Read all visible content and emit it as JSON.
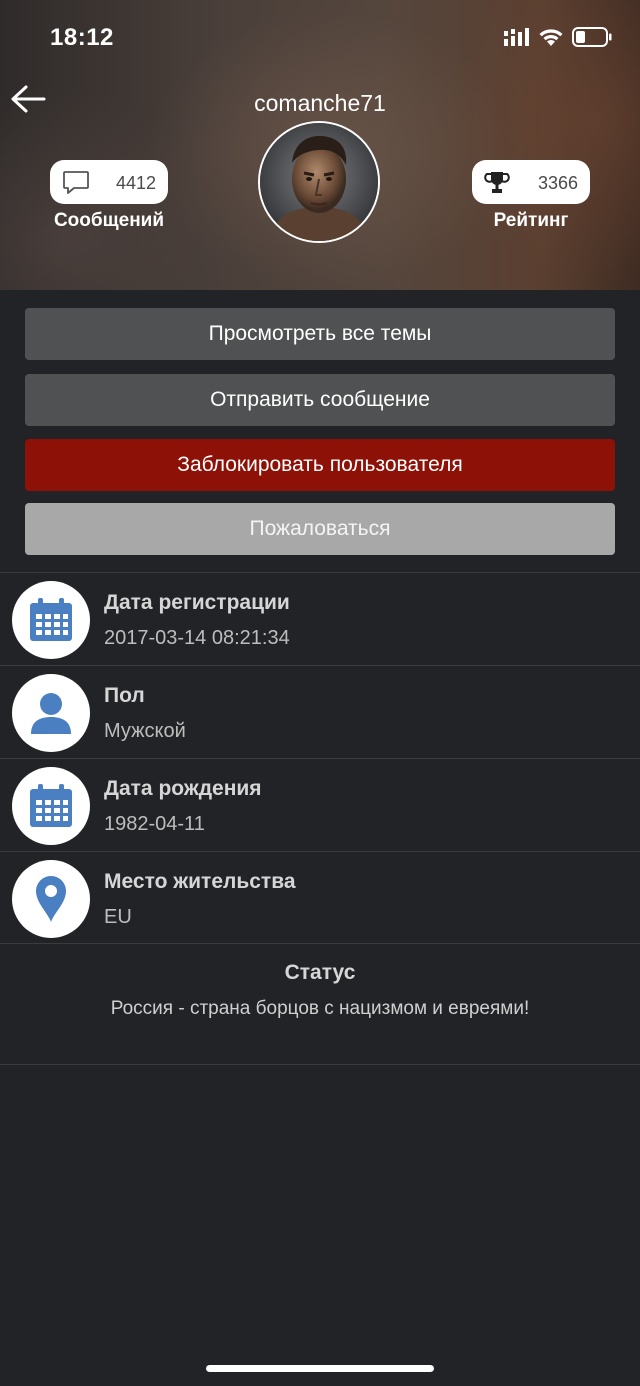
{
  "status_bar": {
    "time": "18:12",
    "icons": [
      "signal-icon",
      "wifi-icon",
      "battery-icon"
    ]
  },
  "header": {
    "username": "comanche71",
    "back_icon": "arrow-left-icon",
    "messages": {
      "count": "4412",
      "label": "Сообщений",
      "icon": "speech-bubble-icon"
    },
    "rating": {
      "count": "3366",
      "label": "Рейтинг",
      "icon": "trophy-icon"
    }
  },
  "actions": {
    "view_topics": "Просмотреть все темы",
    "send_message": "Отправить сообщение",
    "block_user": "Заблокировать пользователя",
    "report": "Пожаловаться"
  },
  "info": [
    {
      "label": "Дата регистрации",
      "value": "2017-03-14 08:21:34",
      "icon": "calendar-icon"
    },
    {
      "label": "Пол",
      "value": "Мужской",
      "icon": "person-icon"
    },
    {
      "label": "Дата рождения",
      "value": "1982-04-11",
      "icon": "calendar-icon"
    },
    {
      "label": "Место жительства",
      "value": "EU",
      "icon": "location-pin-icon"
    }
  ],
  "status": {
    "title": "Статус",
    "text": "Россия - страна борцов с нацизмом и евреями!"
  },
  "colors": {
    "background": "#222326",
    "button_dark": "#505153",
    "button_red": "#8e1108",
    "button_gray": "#a8a8a8",
    "icon_blue": "#4a7fc1"
  }
}
